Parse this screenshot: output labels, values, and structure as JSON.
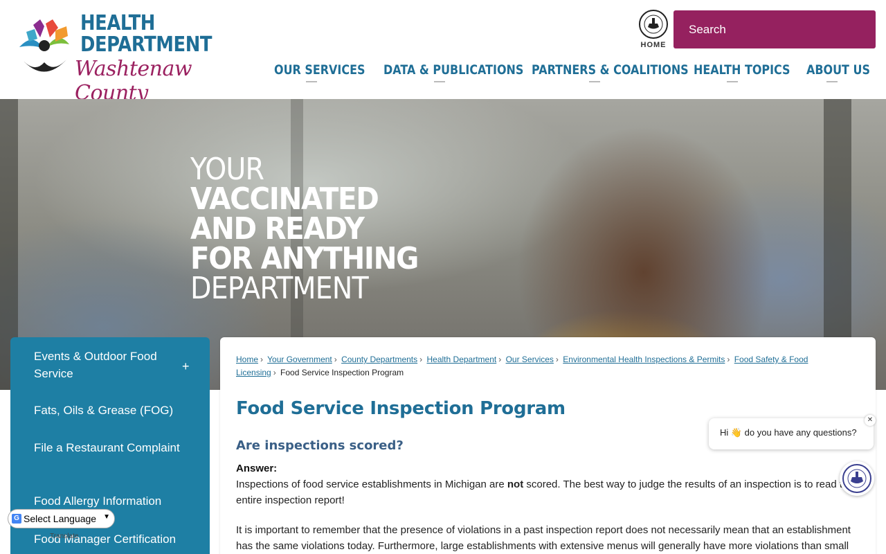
{
  "header": {
    "logo": {
      "line1": "HEALTH",
      "line2": "DEPARTMENT",
      "script": "Washtenaw County"
    },
    "home_label": "HOME",
    "search_placeholder": "Search",
    "nav": [
      "OUR SERVICES",
      "DATA & PUBLICATIONS",
      "PARTNERS & COALITIONS",
      "HEALTH TOPICS",
      "ABOUT US"
    ]
  },
  "hero": {
    "line1": "YOUR",
    "line2": "VACCINATED",
    "line3": "AND READY",
    "line4": "FOR ANYTHING",
    "line5": "DEPARTMENT"
  },
  "sidebar": {
    "items": [
      "Events & Outdoor Food Service",
      "Fats, Oils & Grease (FOG)",
      "File a Restaurant Complaint",
      "Food Allergy Information",
      "Food Manager Certification"
    ],
    "expand_symbol": "+"
  },
  "breadcrumb": {
    "links": [
      "Home",
      "Your Government",
      "County Departments",
      "Health Department",
      "Our Services",
      "Environmental Health Inspections & Permits",
      "Food Safety & Food Licensing"
    ],
    "current": "Food Service Inspection Program"
  },
  "content": {
    "title": "Food Service Inspection Program",
    "question": "Are inspections scored?",
    "answer_label": "Answer:",
    "para1_a": "Inspections of food service establishments in Michigan are ",
    "para1_bold": "not",
    "para1_b": " scored. The best way to judge the results of an inspection is to read the entire inspection report!",
    "para2": "It is important to remember that the presence of violations in a past inspection report does not necessarily mean that an establishment has the same violations today. Furthermore, large establishments with extensive menus will generally have more violations than small"
  },
  "chat": {
    "message": "Hi 👋 do you have any questions?",
    "close": "✕"
  },
  "translate": {
    "label": "Select Language",
    "powered": "Translate"
  },
  "colors": {
    "brand_blue": "#1f6e96",
    "brand_magenta": "#95215f",
    "sidebar_blue": "#1e7fa4"
  }
}
